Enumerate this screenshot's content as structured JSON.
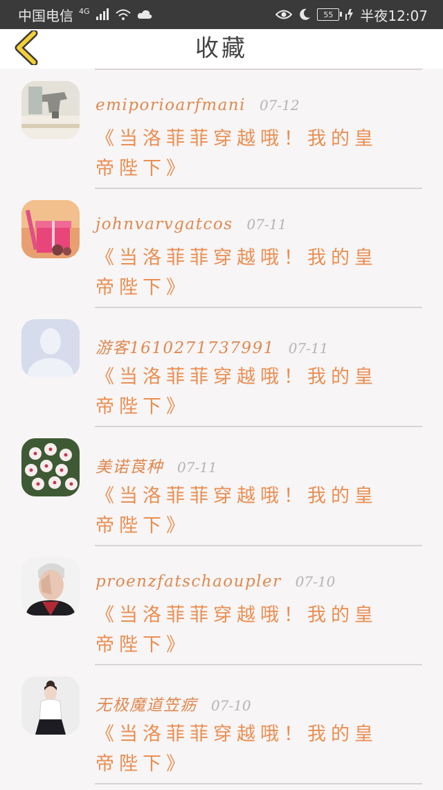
{
  "status_bar": {
    "carrier": "中国电信",
    "network": "4G",
    "battery": "55",
    "time": "半夜12:07"
  },
  "header": {
    "title": "收藏"
  },
  "colors": {
    "accent": "#ea8e52",
    "date": "#b5b5b5",
    "back_arrow": "#f3d037"
  },
  "items": [
    {
      "name": "emiporioarfmani",
      "date": "07-12",
      "message": "《当洛菲菲穿越哦！我的皇帝陛下》",
      "avatar": "sewing-machine-avatar"
    },
    {
      "name": "johnvarvgatcos",
      "date": "07-11",
      "message": "《当洛菲菲穿越哦！我的皇帝陛下》",
      "avatar": "gift-box-avatar"
    },
    {
      "name": "游客1610271737991",
      "date": "07-11",
      "message": "《当洛菲菲穿越哦！我的皇帝陛下》",
      "avatar": "default-user-avatar"
    },
    {
      "name": "美诺莨种",
      "date": "07-11",
      "message": "《当洛菲菲穿越哦！我的皇帝陛下》",
      "avatar": "flowers-avatar"
    },
    {
      "name": "proenzfatschaoupler",
      "date": "07-10",
      "message": "《当洛菲菲穿越哦！我的皇帝陛下》",
      "avatar": "man-portrait-avatar"
    },
    {
      "name": "无极魔道笠疬",
      "date": "07-10",
      "message": "《当洛菲菲穿越哦！我的皇帝陛下》",
      "avatar": "girl-portrait-avatar"
    }
  ]
}
